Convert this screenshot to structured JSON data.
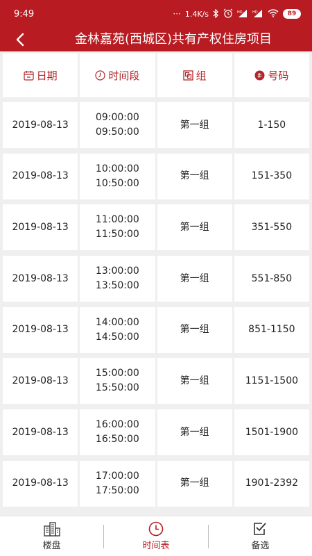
{
  "status_bar": {
    "time": "9:49",
    "network_speed": "1.4K/s",
    "battery": "89",
    "icons": [
      "signal-dots-icon",
      "bluetooth-icon",
      "alarm-icon",
      "hd-signal-icon",
      "hd-signal-icon",
      "wifi-icon",
      "battery-icon"
    ]
  },
  "header": {
    "title": "金林嘉苑(西城区)共有产权住房项目",
    "back_icon": "back-arrow-icon"
  },
  "table": {
    "columns": [
      {
        "label": "日期",
        "icon": "calendar-icon"
      },
      {
        "label": "时间段",
        "icon": "clock-icon"
      },
      {
        "label": "组",
        "icon": "group-icon"
      },
      {
        "label": "号码",
        "icon": "number-badge-icon"
      }
    ],
    "rows": [
      {
        "date": "2019-08-13",
        "start": "09:00:00",
        "end": "09:50:00",
        "group": "第一组",
        "number": "1-150"
      },
      {
        "date": "2019-08-13",
        "start": "10:00:00",
        "end": "10:50:00",
        "group": "第一组",
        "number": "151-350"
      },
      {
        "date": "2019-08-13",
        "start": "11:00:00",
        "end": "11:50:00",
        "group": "第一组",
        "number": "351-550"
      },
      {
        "date": "2019-08-13",
        "start": "13:00:00",
        "end": "13:50:00",
        "group": "第一组",
        "number": "551-850"
      },
      {
        "date": "2019-08-13",
        "start": "14:00:00",
        "end": "14:50:00",
        "group": "第一组",
        "number": "851-1150"
      },
      {
        "date": "2019-08-13",
        "start": "15:00:00",
        "end": "15:50:00",
        "group": "第一组",
        "number": "1151-1500"
      },
      {
        "date": "2019-08-13",
        "start": "16:00:00",
        "end": "16:50:00",
        "group": "第一组",
        "number": "1501-1900"
      },
      {
        "date": "2019-08-13",
        "start": "17:00:00",
        "end": "17:50:00",
        "group": "第一组",
        "number": "1901-2392"
      }
    ]
  },
  "bottom_nav": {
    "tabs": [
      {
        "label": "楼盘",
        "icon": "building-icon",
        "active": false
      },
      {
        "label": "时间表",
        "icon": "clock-icon",
        "active": true
      },
      {
        "label": "备选",
        "icon": "checkbox-icon",
        "active": false
      }
    ]
  },
  "colors": {
    "brand": "#b81c22",
    "header_text": "#b0262a",
    "background": "#efefef"
  }
}
